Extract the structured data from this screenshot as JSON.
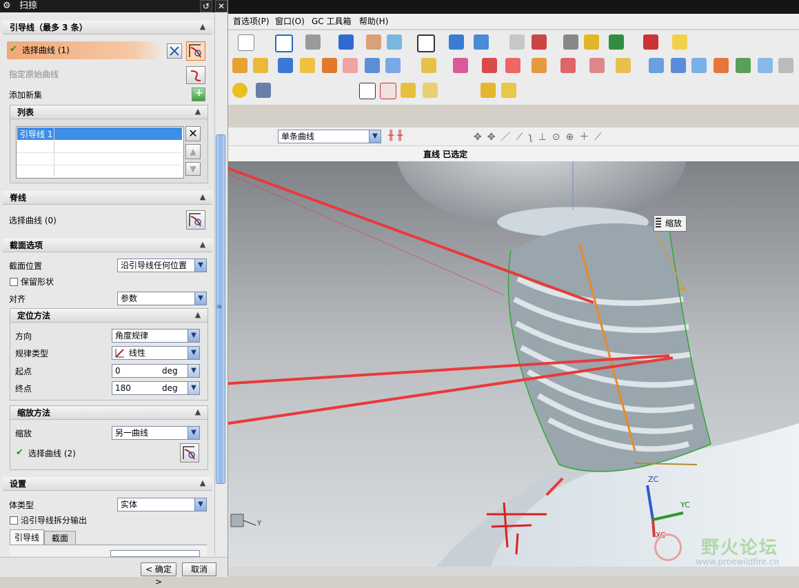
{
  "dialog": {
    "title": "扫掠",
    "guides": {
      "header": "引导线（最多 3 条）",
      "select_curve": "选择曲线 (1)",
      "specify_origin": "指定原始曲线",
      "add_new_set": "添加新集",
      "list_header": "列表",
      "list_items": [
        "引导线 1"
      ]
    },
    "spine": {
      "header": "脊线",
      "select_curve": "选择曲线 (0)"
    },
    "section_options": {
      "header": "截面选项",
      "position_label": "截面位置",
      "position_value": "沿引导线任何位置",
      "keep_shape": "保留形状",
      "align_label": "对齐",
      "align_value": "参数",
      "orientation": {
        "header": "定位方法",
        "direction_label": "方向",
        "direction_value": "角度规律",
        "law_type_label": "规律类型",
        "law_type_value": "线性",
        "start_label": "起点",
        "start_value": "0",
        "start_unit": "deg",
        "end_label": "终点",
        "end_value": "180",
        "end_unit": "deg"
      },
      "scaling": {
        "header": "缩放方法",
        "scale_label": "缩放",
        "scale_value": "另一曲线",
        "select_curve": "选择曲线 (2)"
      }
    },
    "settings": {
      "header": "设置",
      "body_type_label": "体类型",
      "body_type_value": "实体",
      "split_output": "沿引导线拆分输出",
      "tabs": [
        "引导线",
        "截面"
      ]
    },
    "ok_label": "< 确定 >",
    "cancel_label": "取消"
  },
  "menu": {
    "items": [
      "首选项(P)",
      "窗口(O)",
      "GC 工具箱",
      "帮助(H)"
    ]
  },
  "selection_bar": {
    "filter_value": "单条曲线"
  },
  "status": {
    "message": "直线 已选定"
  },
  "viewport": {
    "scale_tag": "缩放",
    "axes": {
      "z": "ZC",
      "y": "YC",
      "x": "XC",
      "small_y": "Y"
    },
    "watermark_title": "野火论坛",
    "watermark_url": "www.proewildfire.cn",
    "handwriting": "赤"
  },
  "colors": {
    "accent_orange": "#f0a878",
    "selection_blue": "#3d8ee6",
    "arrow_red": "#e83a3a"
  }
}
